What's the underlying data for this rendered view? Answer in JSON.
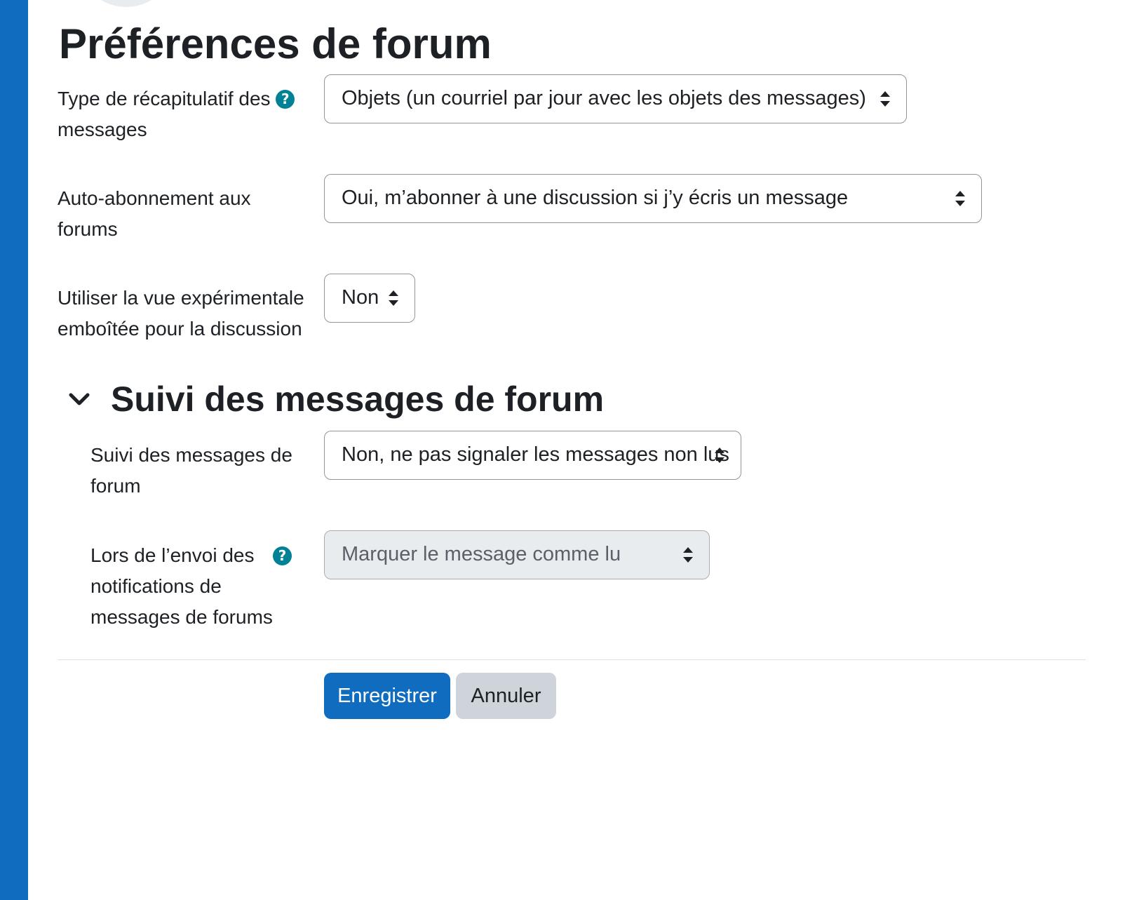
{
  "page": {
    "title": "Préférences de forum"
  },
  "fields": {
    "digest_type": {
      "label_line1": "Type de récapitulatif des",
      "label_line2": "messages",
      "help_icon": "question-circle-icon",
      "value": "Objets (un courriel par jour avec les objets des messages)"
    },
    "auto_subscribe": {
      "label_line1": "Auto-abonnement aux",
      "label_line2": "forums",
      "value": "Oui, m’abonner à une discussion si j’y écris un message"
    },
    "nested_view": {
      "label_line1": "Utiliser la vue expérimentale",
      "label_line2": "emboîtée pour la discussion",
      "value": "Non"
    }
  },
  "tracking_section": {
    "title": "Suivi des messages de forum",
    "expanded": true,
    "chevron_icon": "chevron-down-icon",
    "track_forums": {
      "label_line1": "Suivi des messages de",
      "label_line2": "forum",
      "value": "Non, ne pas signaler les messages non lus"
    },
    "mark_read_on_notification": {
      "label_line1": "Lors de l’envoi des",
      "label_line2": "notifications de",
      "label_line3": "messages de forums",
      "help_icon": "question-circle-icon",
      "value": "Marquer le message comme lu",
      "disabled": true
    }
  },
  "actions": {
    "save_label": "Enregistrer",
    "cancel_label": "Annuler"
  },
  "colors": {
    "primary": "#0f6cbf",
    "help_icon": "#008196",
    "secondary_button": "#ced4da",
    "disabled_field": "#e9ecef"
  }
}
